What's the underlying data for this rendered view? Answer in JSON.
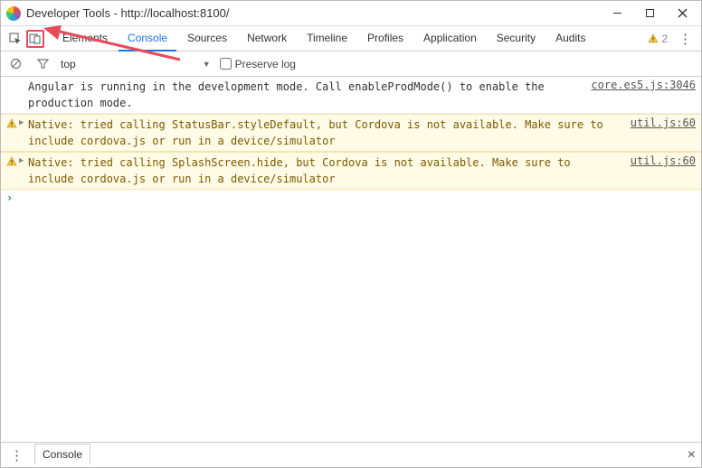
{
  "window": {
    "title": "Developer Tools - http://localhost:8100/"
  },
  "tabs": {
    "items": [
      "Elements",
      "Console",
      "Sources",
      "Network",
      "Timeline",
      "Profiles",
      "Application",
      "Security",
      "Audits"
    ],
    "active": "Console"
  },
  "toolbar": {
    "warn_count": "2"
  },
  "filter": {
    "context": "top",
    "preserve_log_label": "Preserve log"
  },
  "messages": [
    {
      "level": "info",
      "text": "Angular is running in the development mode. Call enableProdMode() to enable the production mode.",
      "source": "core.es5.js:3046"
    },
    {
      "level": "warn",
      "text": "Native: tried calling StatusBar.styleDefault, but Cordova is not available. Make sure to include cordova.js or run in a device/simulator",
      "source": "util.js:60"
    },
    {
      "level": "warn",
      "text": "Native: tried calling SplashScreen.hide, but Cordova is not available. Make sure to include cordova.js or run in a device/simulator",
      "source": "util.js:60"
    }
  ],
  "prompt": {
    "value": ""
  },
  "drawer": {
    "tab": "Console"
  }
}
